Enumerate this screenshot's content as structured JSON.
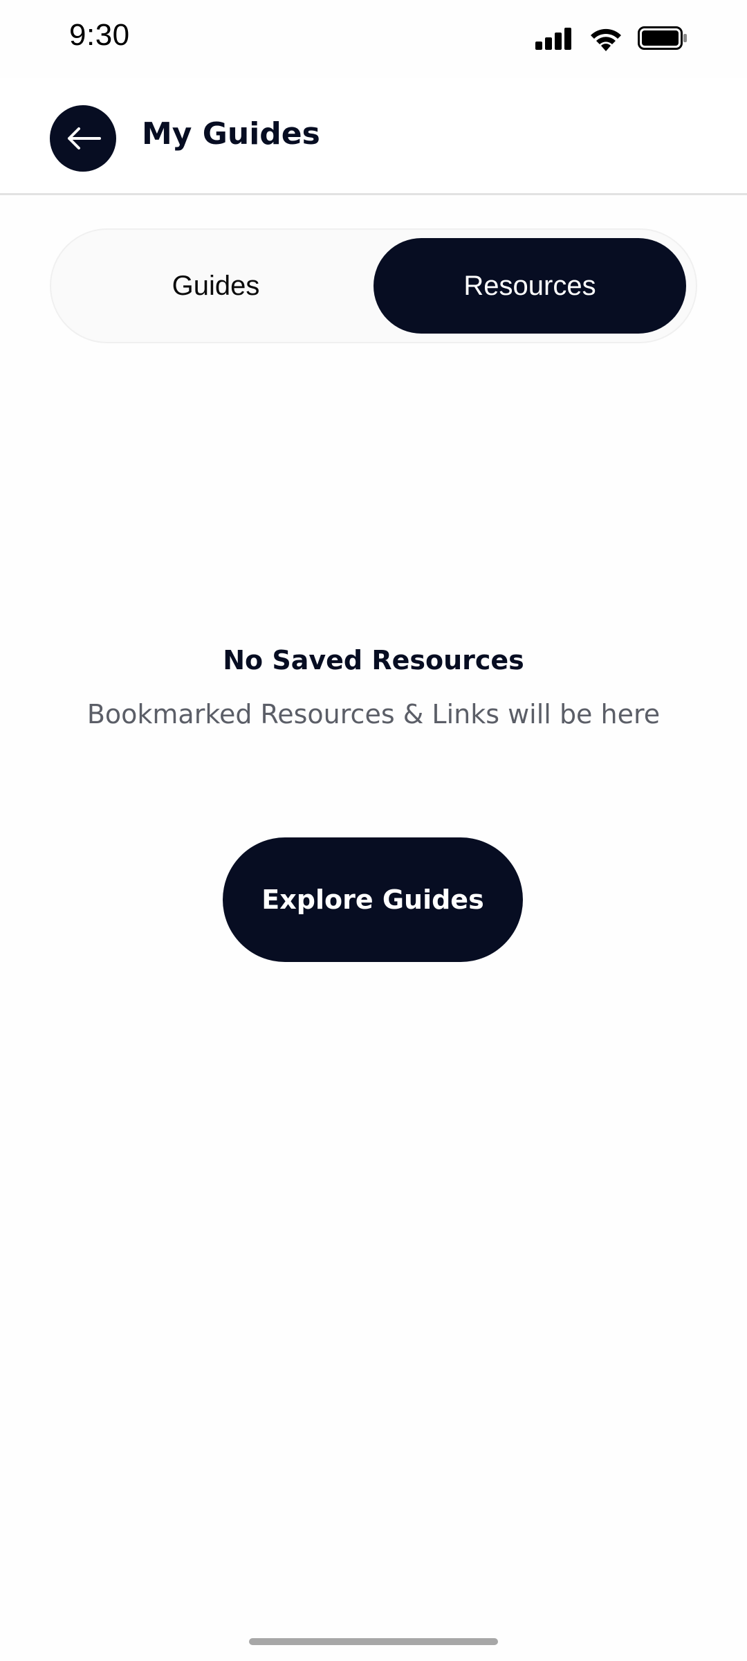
{
  "status_bar": {
    "time": "9:30",
    "icons": [
      "cellular-signal-icon",
      "wifi-icon",
      "battery-icon"
    ]
  },
  "header": {
    "back_icon": "arrow-left-icon",
    "title": "My Guides"
  },
  "tabs": [
    {
      "label": "Guides",
      "selected": false
    },
    {
      "label": "Resources",
      "selected": true
    }
  ],
  "empty_state": {
    "title": "No Saved Resources",
    "subtitle": "Bookmarked Resources & Links will be here",
    "cta_label": "Explore Guides"
  },
  "colors": {
    "primary": "#070d22",
    "subtitle_text": "#5b5e67",
    "background": "#fefefe",
    "home_indicator": "#a7a7a7"
  }
}
